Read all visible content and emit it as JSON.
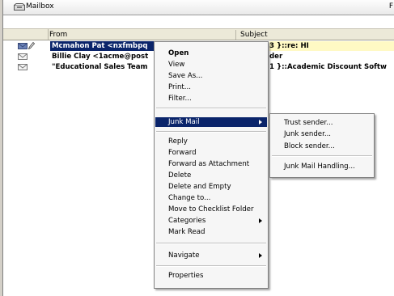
{
  "window": {
    "title": "Mailbox",
    "title_right": "F"
  },
  "columns": {
    "from": "From",
    "subject": "Subject"
  },
  "messages": [
    {
      "from": "Mcmahon Pat <nxfmbpq",
      "subject": "3 }::re: HI",
      "selected": true
    },
    {
      "from": "Billie Clay <1acme@post",
      "subject": "der",
      "selected": false
    },
    {
      "from": "\"Educational Sales Team",
      "subject": "1 }::Academic Discount Softw",
      "selected": false
    }
  ],
  "context_menu": {
    "items": [
      {
        "label": "Open"
      },
      {
        "label": "View"
      },
      {
        "label": "Save As..."
      },
      {
        "label": "Print..."
      },
      {
        "label": "Filter..."
      },
      {
        "label": "Junk Mail"
      },
      {
        "label": "Reply"
      },
      {
        "label": "Forward"
      },
      {
        "label": "Forward as Attachment"
      },
      {
        "label": "Delete"
      },
      {
        "label": "Delete and Empty"
      },
      {
        "label": "Change to..."
      },
      {
        "label": "Move to Checklist Folder"
      },
      {
        "label": "Categories"
      },
      {
        "label": "Mark Read"
      },
      {
        "label": "Navigate"
      },
      {
        "label": "Properties"
      }
    ]
  },
  "junk_submenu": {
    "items": [
      {
        "label": "Trust sender..."
      },
      {
        "label": "Junk sender..."
      },
      {
        "label": "Block sender..."
      },
      {
        "label": "Junk Mail Handling..."
      }
    ]
  },
  "colors": {
    "selection": "#0a246a",
    "menu_bg": "#f6f6f6",
    "header_bg": "#ece9d8"
  },
  "icons": [
    "mailbox-icon",
    "envelope-icon",
    "pencil-icon",
    "submenu-arrow-icon"
  ]
}
